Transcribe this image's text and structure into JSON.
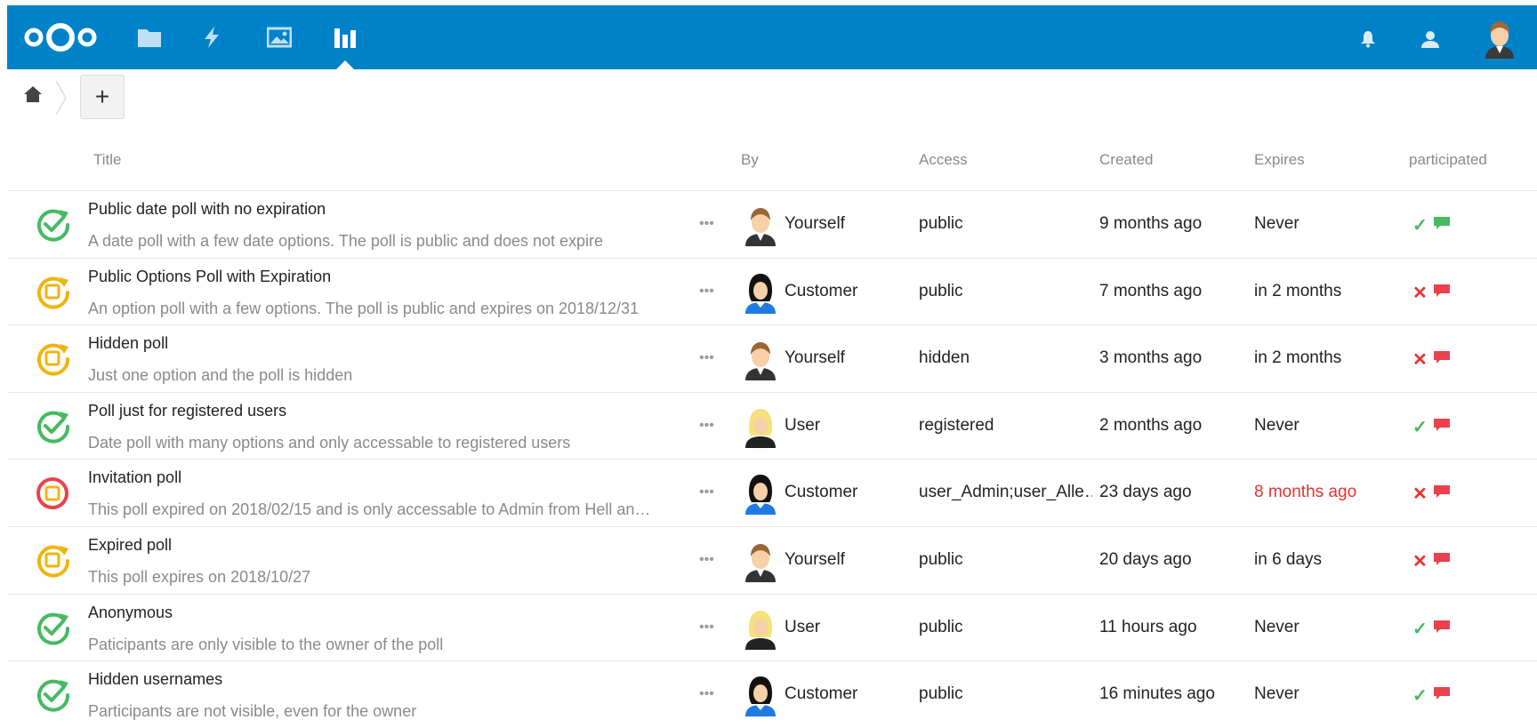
{
  "header": {
    "nav": [
      "files-icon",
      "activity-icon",
      "gallery-icon",
      "polls-icon"
    ],
    "right": [
      "notifications-icon",
      "contacts-icon",
      "avatar"
    ],
    "brand_color": "#0082c9"
  },
  "breadcrumb": {
    "add_label": "+"
  },
  "columns": {
    "title": "Title",
    "by": "By",
    "access": "Access",
    "created": "Created",
    "expires": "Expires",
    "participated": "participated"
  },
  "rows": [
    {
      "title": "Public date poll with no expiration",
      "description": "A date poll with a few date options. The poll is public and does not expire",
      "more": "•••",
      "owner": "Yourself",
      "avatar": "man",
      "access": "public",
      "created": "9 months ago",
      "expires": "Never",
      "expired": false,
      "status": "green",
      "participated": "✓",
      "voted": true,
      "commented": true
    },
    {
      "title": "Public Options Poll with Expiration",
      "description": "An option poll with a few options. The poll is public and expires on 2018/12/31",
      "more": "•••",
      "owner": "Customer",
      "avatar": "woman",
      "access": "public",
      "created": "7 months ago",
      "expires": "in 2 months",
      "expired": false,
      "status": "yellow",
      "participated": "✕",
      "voted": false,
      "commented": false
    },
    {
      "title": "Hidden poll",
      "description": "Just one option and the poll is hidden",
      "more": "•••",
      "owner": "Yourself",
      "avatar": "man",
      "access": "hidden",
      "created": "3 months ago",
      "expires": "in 2 months",
      "expired": false,
      "status": "yellow",
      "participated": "✕",
      "voted": false,
      "commented": false
    },
    {
      "title": "Poll just for registered users",
      "description": "Date poll with many options and only accessable to registered users",
      "more": "•••",
      "owner": "User",
      "avatar": "blonde",
      "access": "registered",
      "created": "2 months ago",
      "expires": "Never",
      "expired": false,
      "status": "green",
      "participated": "✓",
      "voted": true,
      "commented": false
    },
    {
      "title": "Invitation poll",
      "description": "This poll expired on 2018/02/15 and is only accessable to Admin from Hell an…",
      "more": "•••",
      "owner": "Customer",
      "avatar": "woman",
      "access": "user_Admin;user_Alle…",
      "created": "23 days ago",
      "expires": "8 months ago",
      "expired": true,
      "status": "red",
      "participated": "✕",
      "voted": false,
      "commented": false
    },
    {
      "title": "Expired poll",
      "description": "This poll expires on 2018/10/27",
      "more": "•••",
      "owner": "Yourself",
      "avatar": "man",
      "access": "public",
      "created": "20 days ago",
      "expires": "in 6 days",
      "expired": false,
      "status": "yellow",
      "participated": "✕",
      "voted": false,
      "commented": false
    },
    {
      "title": "Anonymous",
      "description": "Paticipants are only visible to the owner of the poll",
      "more": "•••",
      "owner": "User",
      "avatar": "blonde",
      "access": "public",
      "created": "11 hours ago",
      "expires": "Never",
      "expired": false,
      "status": "green",
      "participated": "✓",
      "voted": true,
      "commented": false
    },
    {
      "title": "Hidden usernames",
      "description": "Participants are not visible, even for the owner",
      "more": "•••",
      "owner": "Customer",
      "avatar": "woman",
      "access": "public",
      "created": "16 minutes ago",
      "expires": "Never",
      "expired": false,
      "status": "green",
      "participated": "✓",
      "voted": true,
      "commented": false
    }
  ],
  "colors": {
    "green": "#46ba61",
    "yellow": "#f0b410",
    "red": "#e9414e",
    "comment_active": "#46ba61",
    "comment_inactive": "#e9414e"
  }
}
